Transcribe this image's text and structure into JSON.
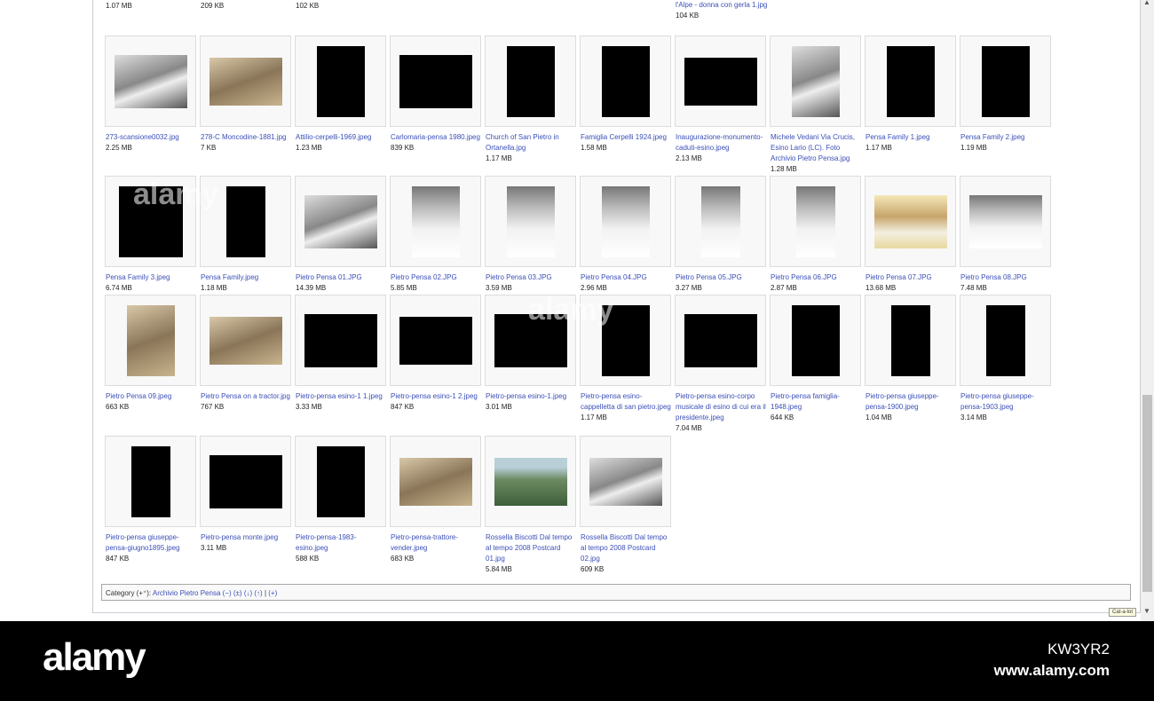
{
  "gallery": {
    "top_partial": [
      {
        "col": 0,
        "size": "1.07 MB"
      },
      {
        "col": 1,
        "size": "209 KB"
      },
      {
        "col": 2,
        "size": "102 KB"
      },
      {
        "col": 6,
        "name": "l'Alpe - donna con gerla 1.jpg",
        "size": "104 KB"
      }
    ],
    "rows": [
      [
        {
          "name": "273-scansione0032.jpg",
          "size": "2.25 MB",
          "shape": "landscape",
          "tone": "bw"
        },
        {
          "name": "278-C Moncodine-1881.jpg",
          "size": "7 KB",
          "shape": "landscape-short",
          "tone": "sepia"
        },
        {
          "name": "Attilio-cerpelli-1969.jpeg",
          "size": "1.23 MB",
          "shape": "portrait",
          "tone": "black"
        },
        {
          "name": "Carlomaria-pensa 1980.jpeg",
          "size": "839 KB",
          "shape": "landscape",
          "tone": "black"
        },
        {
          "name": "Church of San Pietro in Ortanella.jpg",
          "size": "1.17 MB",
          "shape": "portrait",
          "tone": "black"
        },
        {
          "name": "Famiglia Cerpelli 1924.jpeg",
          "size": "1.58 MB",
          "shape": "portrait",
          "tone": "black"
        },
        {
          "name": "Inaugurazione-monumento-caduti-esino.jpeg",
          "size": "2.13 MB",
          "shape": "landscape-short",
          "tone": "black"
        },
        {
          "name": "Michele Vedani Via Crucis, Esino Lario (LC). Foto Archivio Pietro Pensa.jpg",
          "size": "1.28 MB",
          "shape": "portrait",
          "tone": "bw"
        },
        {
          "name": "Pensa Family 1.jpeg",
          "size": "1.17 MB",
          "shape": "portrait",
          "tone": "black"
        },
        {
          "name": "Pensa Family 2.jpeg",
          "size": "1.19 MB",
          "shape": "portrait",
          "tone": "black"
        }
      ],
      [
        {
          "name": "Pensa Family 3.jpeg",
          "size": "6.74 MB",
          "shape": "wide-portrait",
          "tone": "black"
        },
        {
          "name": "Pensa Family.jpeg",
          "size": "1.18 MB",
          "shape": "narrow",
          "tone": "black"
        },
        {
          "name": "Pietro Pensa 01.JPG",
          "size": "14.39 MB",
          "shape": "landscape",
          "tone": "bw"
        },
        {
          "name": "Pietro Pensa 02.JPG",
          "size": "5.85 MB",
          "shape": "portrait",
          "tone": "bw-snow"
        },
        {
          "name": "Pietro Pensa 03.JPG",
          "size": "3.59 MB",
          "shape": "portrait",
          "tone": "bw-snow"
        },
        {
          "name": "Pietro Pensa 04.JPG",
          "size": "2.96 MB",
          "shape": "portrait",
          "tone": "bw-snow"
        },
        {
          "name": "Pietro Pensa 05.JPG",
          "size": "3.27 MB",
          "shape": "narrow",
          "tone": "bw-snow"
        },
        {
          "name": "Pietro Pensa 06.JPG",
          "size": "2.87 MB",
          "shape": "narrow",
          "tone": "bw-snow"
        },
        {
          "name": "Pietro Pensa 07.JPG",
          "size": "13.68 MB",
          "shape": "landscape",
          "tone": "color-yellow"
        },
        {
          "name": "Pietro Pensa 08.JPG",
          "size": "7.48 MB",
          "shape": "landscape",
          "tone": "bw-snow"
        }
      ],
      [
        {
          "name": "Pietro Pensa 09.jpeg",
          "size": "663 KB",
          "shape": "portrait",
          "tone": "sepia"
        },
        {
          "name": "Pietro Pensa on a tractor.jpg",
          "size": "767 KB",
          "shape": "landscape-short",
          "tone": "sepia"
        },
        {
          "name": "Pietro-pensa esino-1 1.jpeg",
          "size": "3.33 MB",
          "shape": "landscape",
          "tone": "black"
        },
        {
          "name": "Pietro-pensa esino-1 2.jpeg",
          "size": "847 KB",
          "shape": "landscape-short",
          "tone": "black"
        },
        {
          "name": "Pietro-pensa esino-1.jpeg",
          "size": "3.01 MB",
          "shape": "landscape",
          "tone": "black"
        },
        {
          "name": "Pietro-pensa esino-cappelletta di san pietro.jpeg",
          "size": "1.17 MB",
          "shape": "portrait",
          "tone": "black"
        },
        {
          "name": "Pietro-pensa esino-corpo musicale di esino di cui era il presidente.jpeg",
          "size": "7.04 MB",
          "shape": "landscape",
          "tone": "black"
        },
        {
          "name": "Pietro-pensa famiglia-1948.jpeg",
          "size": "644 KB",
          "shape": "portrait",
          "tone": "black"
        },
        {
          "name": "Pietro-pensa giuseppe-pensa-1900.jpeg",
          "size": "1.04 MB",
          "shape": "narrow",
          "tone": "black"
        },
        {
          "name": "Pietro-pensa giuseppe-pensa-1903.jpeg",
          "size": "3.14 MB",
          "shape": "narrow",
          "tone": "black"
        }
      ],
      [
        {
          "name": "Pietro-pensa giuseppe-pensa-giugno1895.jpeg",
          "size": "847 KB",
          "shape": "narrow",
          "tone": "black"
        },
        {
          "name": "Pietro-pensa monte.jpeg",
          "size": "3.11 MB",
          "shape": "landscape",
          "tone": "black"
        },
        {
          "name": "Pietro-pensa-1983-esino.jpeg",
          "size": "588 KB",
          "shape": "portrait",
          "tone": "black"
        },
        {
          "name": "Pietro-pensa-trattore-vender.jpeg",
          "size": "683 KB",
          "shape": "landscape-short",
          "tone": "sepia"
        },
        {
          "name": "Rossella Biscotti Dal tempo al tempo 2008 Postcard 01.jpg",
          "size": "5.84 MB",
          "shape": "landscape-short",
          "tone": "color-green"
        },
        {
          "name": "Rossella Biscotti Dal tempo al tempo 2008 Postcard 02.jpg",
          "size": "609 KB",
          "shape": "landscape-short",
          "tone": "bw"
        }
      ]
    ]
  },
  "category_bar": {
    "prefix": "Category (+⁺): ",
    "category": "Archivio Pietro Pensa",
    "actions": [
      "(−)",
      "(±)",
      "(↓)",
      "(↑)"
    ],
    "separator": "|",
    "add": "(+)"
  },
  "tooltip": "Cat-a-lot",
  "watermark": {
    "logo": "alamy",
    "image_id": "KW3YR2",
    "url": "www.alamy.com"
  }
}
